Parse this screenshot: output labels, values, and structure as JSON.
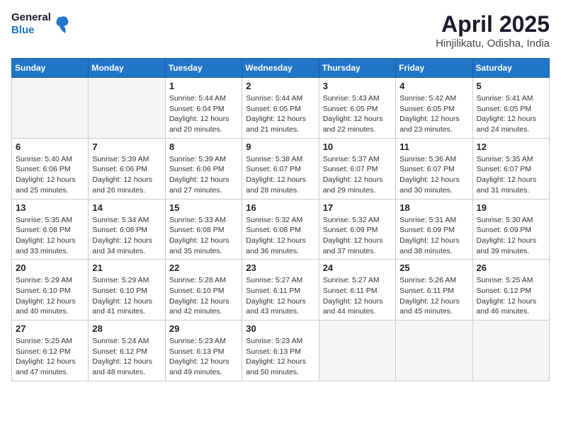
{
  "header": {
    "logo_line1": "General",
    "logo_line2": "Blue",
    "month_title": "April 2025",
    "location": "Hinjilikatu, Odisha, India"
  },
  "weekdays": [
    "Sunday",
    "Monday",
    "Tuesday",
    "Wednesday",
    "Thursday",
    "Friday",
    "Saturday"
  ],
  "weeks": [
    [
      {
        "day": "",
        "empty": true
      },
      {
        "day": "",
        "empty": true
      },
      {
        "day": "1",
        "sunrise": "5:44 AM",
        "sunset": "6:04 PM",
        "daylight": "12 hours and 20 minutes."
      },
      {
        "day": "2",
        "sunrise": "5:44 AM",
        "sunset": "6:05 PM",
        "daylight": "12 hours and 21 minutes."
      },
      {
        "day": "3",
        "sunrise": "5:43 AM",
        "sunset": "6:05 PM",
        "daylight": "12 hours and 22 minutes."
      },
      {
        "day": "4",
        "sunrise": "5:42 AM",
        "sunset": "6:05 PM",
        "daylight": "12 hours and 23 minutes."
      },
      {
        "day": "5",
        "sunrise": "5:41 AM",
        "sunset": "6:05 PM",
        "daylight": "12 hours and 24 minutes."
      }
    ],
    [
      {
        "day": "6",
        "sunrise": "5:40 AM",
        "sunset": "6:06 PM",
        "daylight": "12 hours and 25 minutes."
      },
      {
        "day": "7",
        "sunrise": "5:39 AM",
        "sunset": "6:06 PM",
        "daylight": "12 hours and 26 minutes."
      },
      {
        "day": "8",
        "sunrise": "5:39 AM",
        "sunset": "6:06 PM",
        "daylight": "12 hours and 27 minutes."
      },
      {
        "day": "9",
        "sunrise": "5:38 AM",
        "sunset": "6:07 PM",
        "daylight": "12 hours and 28 minutes."
      },
      {
        "day": "10",
        "sunrise": "5:37 AM",
        "sunset": "6:07 PM",
        "daylight": "12 hours and 29 minutes."
      },
      {
        "day": "11",
        "sunrise": "5:36 AM",
        "sunset": "6:07 PM",
        "daylight": "12 hours and 30 minutes."
      },
      {
        "day": "12",
        "sunrise": "5:35 AM",
        "sunset": "6:07 PM",
        "daylight": "12 hours and 31 minutes."
      }
    ],
    [
      {
        "day": "13",
        "sunrise": "5:35 AM",
        "sunset": "6:08 PM",
        "daylight": "12 hours and 33 minutes."
      },
      {
        "day": "14",
        "sunrise": "5:34 AM",
        "sunset": "6:08 PM",
        "daylight": "12 hours and 34 minutes."
      },
      {
        "day": "15",
        "sunrise": "5:33 AM",
        "sunset": "6:08 PM",
        "daylight": "12 hours and 35 minutes."
      },
      {
        "day": "16",
        "sunrise": "5:32 AM",
        "sunset": "6:08 PM",
        "daylight": "12 hours and 36 minutes."
      },
      {
        "day": "17",
        "sunrise": "5:32 AM",
        "sunset": "6:09 PM",
        "daylight": "12 hours and 37 minutes."
      },
      {
        "day": "18",
        "sunrise": "5:31 AM",
        "sunset": "6:09 PM",
        "daylight": "12 hours and 38 minutes."
      },
      {
        "day": "19",
        "sunrise": "5:30 AM",
        "sunset": "6:09 PM",
        "daylight": "12 hours and 39 minutes."
      }
    ],
    [
      {
        "day": "20",
        "sunrise": "5:29 AM",
        "sunset": "6:10 PM",
        "daylight": "12 hours and 40 minutes."
      },
      {
        "day": "21",
        "sunrise": "5:29 AM",
        "sunset": "6:10 PM",
        "daylight": "12 hours and 41 minutes."
      },
      {
        "day": "22",
        "sunrise": "5:28 AM",
        "sunset": "6:10 PM",
        "daylight": "12 hours and 42 minutes."
      },
      {
        "day": "23",
        "sunrise": "5:27 AM",
        "sunset": "6:11 PM",
        "daylight": "12 hours and 43 minutes."
      },
      {
        "day": "24",
        "sunrise": "5:27 AM",
        "sunset": "6:11 PM",
        "daylight": "12 hours and 44 minutes."
      },
      {
        "day": "25",
        "sunrise": "5:26 AM",
        "sunset": "6:11 PM",
        "daylight": "12 hours and 45 minutes."
      },
      {
        "day": "26",
        "sunrise": "5:25 AM",
        "sunset": "6:12 PM",
        "daylight": "12 hours and 46 minutes."
      }
    ],
    [
      {
        "day": "27",
        "sunrise": "5:25 AM",
        "sunset": "6:12 PM",
        "daylight": "12 hours and 47 minutes."
      },
      {
        "day": "28",
        "sunrise": "5:24 AM",
        "sunset": "6:12 PM",
        "daylight": "12 hours and 48 minutes."
      },
      {
        "day": "29",
        "sunrise": "5:23 AM",
        "sunset": "6:13 PM",
        "daylight": "12 hours and 49 minutes."
      },
      {
        "day": "30",
        "sunrise": "5:23 AM",
        "sunset": "6:13 PM",
        "daylight": "12 hours and 50 minutes."
      },
      {
        "day": "",
        "empty": true
      },
      {
        "day": "",
        "empty": true
      },
      {
        "day": "",
        "empty": true
      }
    ]
  ]
}
